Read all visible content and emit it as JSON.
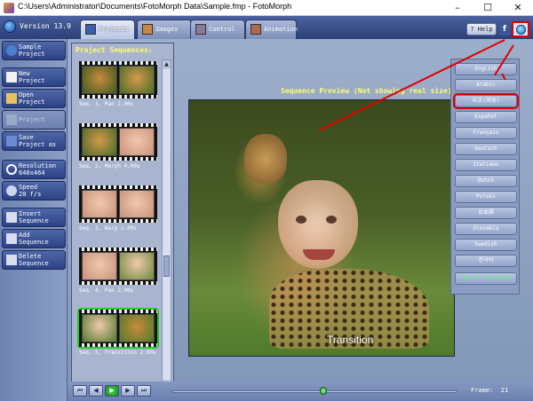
{
  "window": {
    "title": "C:\\Users\\Administrator\\Documents\\FotoMorph Data\\Sample.fmp - FotoMorph",
    "minimize": "–",
    "maximize": "☐",
    "close": "✕"
  },
  "header": {
    "version": "Version 13.9",
    "tabs": [
      {
        "label": "Projects"
      },
      {
        "label": "Images"
      },
      {
        "label": "Control"
      },
      {
        "label": "Animation"
      }
    ],
    "help_label": "? Help",
    "facebook_label": "f"
  },
  "sidebar": {
    "buttons": [
      {
        "label": "Sample\nProject"
      },
      {
        "label": "New\nProject"
      },
      {
        "label": "Open\nProject"
      },
      {
        "label": "Project"
      },
      {
        "label": "Save\nProject as"
      },
      {
        "label": "Resolution\n640x464"
      },
      {
        "label": "Speed\n20 f/s"
      },
      {
        "label": "Insert\nSequence"
      },
      {
        "label": "Add\nSequence"
      },
      {
        "label": "Delete\nSequence"
      }
    ]
  },
  "sequences": {
    "title": "Project Sequences:",
    "items": [
      {
        "label": "Seq. 1,  Pan 2.00s"
      },
      {
        "label": "Seq. 2,  Morph 4.00s"
      },
      {
        "label": "Seq. 3,  Warp 1.00s"
      },
      {
        "label": "Seq. 4,  Pan 2.00s"
      },
      {
        "label": "Seq. 5,  Transition 2.00s"
      }
    ]
  },
  "preview": {
    "title": "Sequence Preview (Not showing real size)",
    "overlay": "Transition"
  },
  "languages": [
    {
      "label": "English"
    },
    {
      "label": "Arabic"
    },
    {
      "label": "中文(简体)"
    },
    {
      "label": "Español"
    },
    {
      "label": "Français"
    },
    {
      "label": "Deutsch"
    },
    {
      "label": "Italiano"
    },
    {
      "label": "Dutch"
    },
    {
      "label": "Polski"
    },
    {
      "label": "日本語"
    },
    {
      "label": "Slovakia"
    },
    {
      "label": "Swedish"
    },
    {
      "label": "한국어"
    },
    {
      "label": "Add or Translate"
    }
  ],
  "player": {
    "frame_label": "Frame:",
    "frame_value": "21",
    "progress": 0.53
  },
  "colors": {
    "highlight": "#e00000",
    "title_text": "#ffff66",
    "selection": "#22cc22"
  }
}
